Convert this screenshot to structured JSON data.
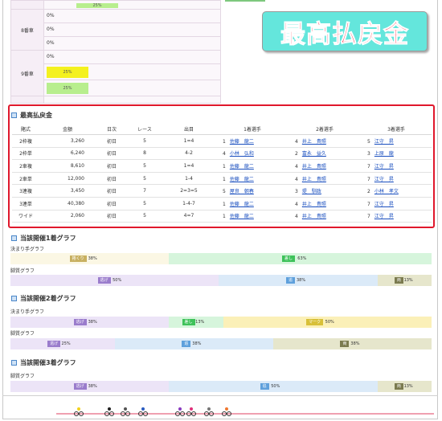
{
  "top": {
    "row_partial": {
      "value": "25%"
    },
    "rows": [
      {
        "label": "8番車",
        "values": [
          "0%",
          "0%",
          "0%"
        ]
      },
      {
        "label": "9番車",
        "values": [
          "0%",
          "25%",
          "25%"
        ]
      }
    ]
  },
  "banner": {
    "text": "最高払戻金"
  },
  "payout": {
    "title": "最高払戻金",
    "headers": [
      "賭式",
      "金額",
      "日次",
      "レース",
      "出目",
      "1着選手",
      "2着選手",
      "3着選手"
    ],
    "rows": [
      {
        "bet": "2枠複",
        "amount": "3,260",
        "day": "初日",
        "race": "5",
        "result": "1=4",
        "r1n": "1",
        "r1": "佐藤　龍二",
        "r2n": "4",
        "r2": "井上　貴照",
        "r3n": "5",
        "r3": "江守　昇"
      },
      {
        "bet": "2枠単",
        "amount": "6,240",
        "day": "初日",
        "race": "8",
        "result": "4-2",
        "r1n": "4",
        "r1": "小林　弘和",
        "r2n": "2",
        "r2": "富永　益久",
        "r3n": "3",
        "r3": "上原　龍"
      },
      {
        "bet": "2車複",
        "amount": "8,610",
        "day": "初日",
        "race": "5",
        "result": "1=4",
        "r1n": "1",
        "r1": "佐藤　龍二",
        "r2n": "4",
        "r2": "井上　貴照",
        "r3n": "7",
        "r3": "江守　昇"
      },
      {
        "bet": "2車単",
        "amount": "12,000",
        "day": "初日",
        "race": "5",
        "result": "1-4",
        "r1n": "1",
        "r1": "佐藤　龍二",
        "r2n": "4",
        "r2": "井上　貴照",
        "r3n": "7",
        "r3": "江守　昇"
      },
      {
        "bet": "3連複",
        "amount": "3,450",
        "day": "初日",
        "race": "7",
        "result": "2=3=5",
        "r1n": "5",
        "r1": "屋良　朝春",
        "r2n": "3",
        "r2": "堤　馴政",
        "r3n": "2",
        "r3": "小林　孝文"
      },
      {
        "bet": "3連単",
        "amount": "40,380",
        "day": "初日",
        "race": "5",
        "result": "1-4-7",
        "r1n": "1",
        "r1": "佐藤　龍二",
        "r2n": "4",
        "r2": "井上　貴照",
        "r3n": "7",
        "r3": "江守　昇"
      },
      {
        "bet": "ワイド",
        "amount": "2,060",
        "day": "初日",
        "race": "5",
        "result": "4=7",
        "r1n": "1",
        "r1": "佐藤　龍二",
        "r2n": "4",
        "r2": "井上　貴照",
        "r3n": "7",
        "r3": "江守　昇"
      }
    ]
  },
  "graphs": {
    "first": {
      "title": "当該開催1着グラフ",
      "kimarite_label": "決まり手グラフ",
      "kimarite": [
        {
          "name": "捲くり",
          "pct": "38%",
          "value": 38,
          "color": "#c8b060",
          "bg": "#fbf7e4"
        },
        {
          "name": "差し",
          "pct": "63%",
          "value": 63,
          "color": "#3ec25a",
          "bg": "#d6f5dc"
        }
      ],
      "kyakushitsu_label": "脚質グラフ",
      "kyakushitsu": [
        {
          "name": "逃げ",
          "pct": "50%",
          "value": 50,
          "color": "#9a7ccc",
          "bg": "#ece4f7"
        },
        {
          "name": "追",
          "pct": "38%",
          "value": 38,
          "color": "#5ea0dc",
          "bg": "#dbeaf8"
        },
        {
          "name": "両",
          "pct": "13%",
          "value": 13,
          "color": "#7b7b50",
          "bg": "#e6e6cc"
        }
      ]
    },
    "second": {
      "title": "当該開催2着グラフ",
      "kimarite_label": "決まり手グラフ",
      "kimarite": [
        {
          "name": "逃げ",
          "pct": "38%",
          "value": 38,
          "color": "#9a7ccc",
          "bg": "#ece4f7"
        },
        {
          "name": "差し",
          "pct": "13%",
          "value": 13,
          "color": "#3ec25a",
          "bg": "#d6f5dc"
        },
        {
          "name": "マーク",
          "pct": "50%",
          "value": 50,
          "color": "#d8c038",
          "bg": "#fbf0b8"
        }
      ],
      "kyakushitsu_label": "脚質グラフ",
      "kyakushitsu": [
        {
          "name": "逃げ",
          "pct": "25%",
          "value": 25,
          "color": "#9a7ccc",
          "bg": "#ece4f7"
        },
        {
          "name": "追",
          "pct": "38%",
          "value": 38,
          "color": "#5ea0dc",
          "bg": "#dbeaf8"
        },
        {
          "name": "両",
          "pct": "38%",
          "value": 38,
          "color": "#7b7b50",
          "bg": "#e6e6cc"
        }
      ]
    },
    "third": {
      "title": "当該開催3着グラフ",
      "kyakushitsu_label": "脚質グラフ",
      "kyakushitsu": [
        {
          "name": "逃げ",
          "pct": "38%",
          "value": 38,
          "color": "#9a7ccc",
          "bg": "#ece4f7"
        },
        {
          "name": "追",
          "pct": "50%",
          "value": 50,
          "color": "#5ea0dc",
          "bg": "#dbeaf8"
        },
        {
          "name": "両",
          "pct": "13%",
          "value": 13,
          "color": "#7b7b50",
          "bg": "#e6e6cc"
        }
      ]
    }
  }
}
